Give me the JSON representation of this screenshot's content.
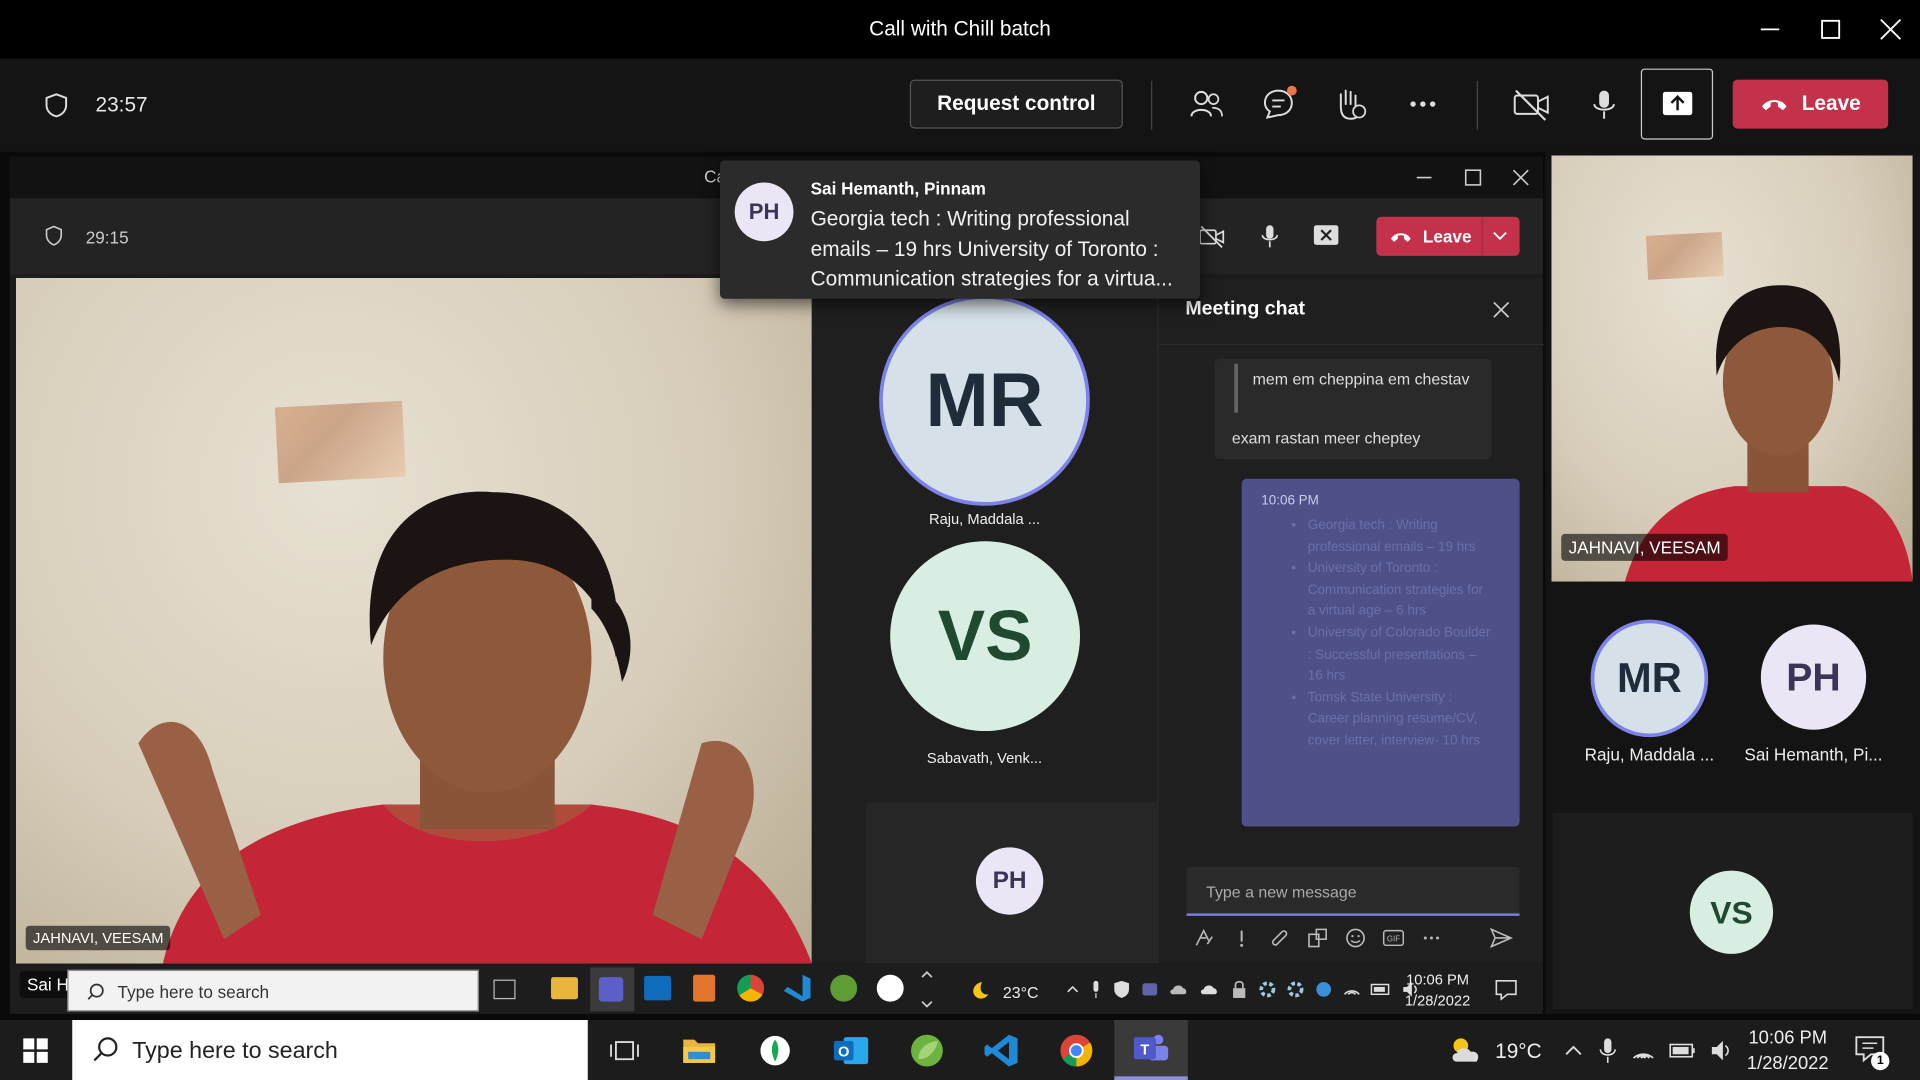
{
  "window": {
    "title": "Call with Chill batch"
  },
  "toolbar": {
    "timer": "23:57",
    "request_control": "Request control",
    "leave": "Leave"
  },
  "inner_window": {
    "title_partial": "Ca",
    "timer": "29:15",
    "leave": "Leave"
  },
  "notification": {
    "initials": "PH",
    "sender": "Sai Hemanth, Pinnam",
    "text": "Georgia tech : Writing professional emails – 19 hrs  University of Toronto : Communication strategies for a virtua..."
  },
  "main_video": {
    "name": "JAHNAVI, VEESAM",
    "overlay_name": "Sai Hemanth, Pinnam"
  },
  "gallery": [
    {
      "initials": "MR",
      "name": "Raju, Maddala ..."
    },
    {
      "initials": "VS",
      "name": "Sabavath, Venk..."
    },
    {
      "initials": "PH",
      "name": ""
    }
  ],
  "chat": {
    "title": "Meeting chat",
    "quote": "mem em cheppina em chestav",
    "reply": "exam rastan meer cheptey",
    "time": "10:06 PM",
    "bullets": [
      "Georgia tech : Writing professional emails – 19 hrs",
      "University of Toronto : Communication strategies for a virtual age – 6 hrs",
      "University of Colorado Boulder : Successful presentations – 16 hrs",
      "Tomsk State University : Career planning resume/CV, cover letter, interview- 10 hrs"
    ],
    "input_placeholder": "Type a new message"
  },
  "inner_taskbar": {
    "search_placeholder": "Type here to search",
    "weather": "23°C",
    "time": "10:06 PM",
    "date": "1/28/2022"
  },
  "right_panel": {
    "video_name": "JAHNAVI, VEESAM",
    "participants": [
      {
        "initials": "MR",
        "name": "Raju, Maddala ..."
      },
      {
        "initials": "PH",
        "name": "Sai Hemanth, Pi..."
      },
      {
        "initials": "VS",
        "name": ""
      }
    ]
  },
  "taskbar": {
    "search_placeholder": "Type here to search",
    "weather": "19°C",
    "time": "10:06 PM",
    "date": "1/28/2022",
    "notification_count": "1"
  },
  "colors": {
    "leave_red": "#c4314b",
    "accent_purple": "#7b83eb",
    "mr_avatar": "#d5e0e8",
    "vs_avatar": "#d8eee2",
    "ph_avatar": "#ebe6f5"
  }
}
